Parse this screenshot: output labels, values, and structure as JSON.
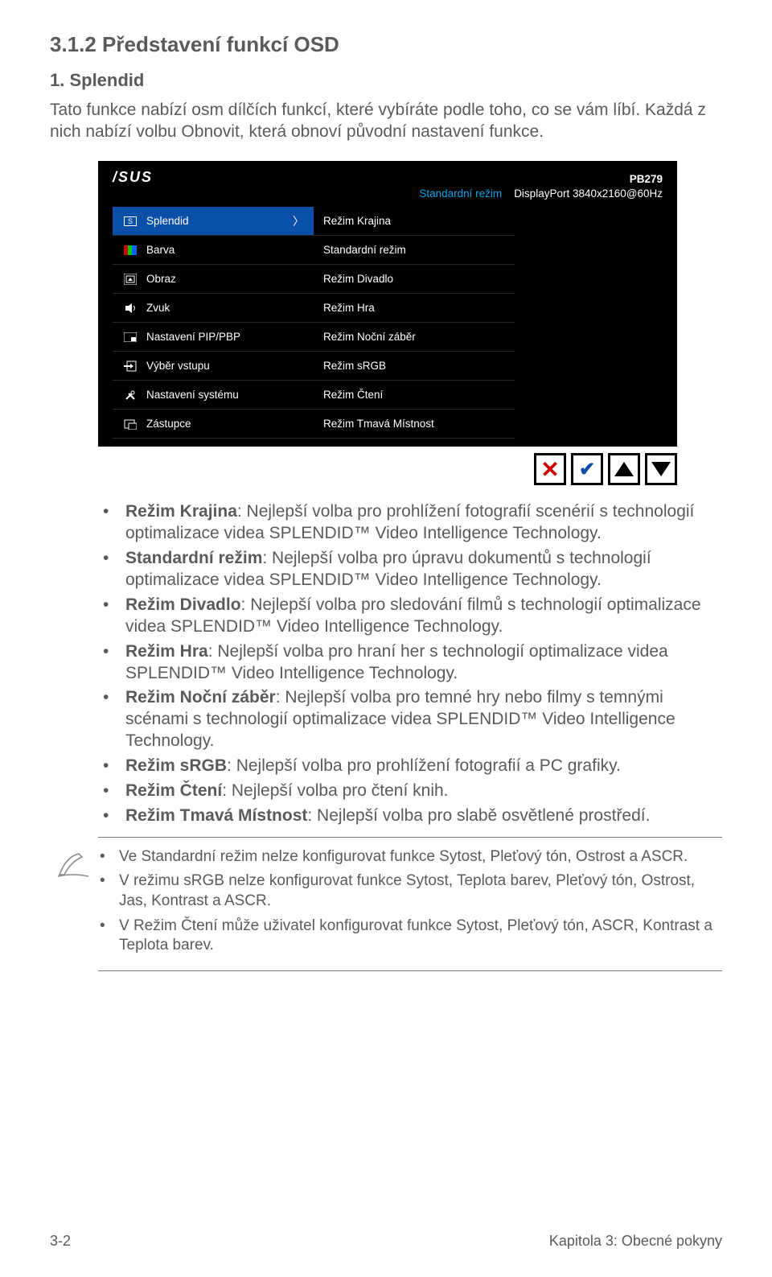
{
  "heading": "3.1.2   Představení funkcí OSD",
  "subheading": "1.   Splendid",
  "intro": "Tato funkce nabízí osm dílčích funkcí, které vybíráte podle toho, co se vám líbí. Každá z nich nabízí volbu Obnovit, která obnoví původní nastavení funkce.",
  "osd": {
    "brand": "/SUS",
    "model": "PB279",
    "status_mode": "Standardní režim",
    "status_signal": "DisplayPort 3840x2160@60Hz",
    "left_menu": [
      {
        "icon": "S",
        "label": "Splendid",
        "selected": true,
        "chevron": true
      },
      {
        "icon": "color",
        "label": "Barva"
      },
      {
        "icon": "image",
        "label": "Obraz"
      },
      {
        "icon": "sound",
        "label": "Zvuk"
      },
      {
        "icon": "pip",
        "label": "Nastavení PIP/PBP"
      },
      {
        "icon": "input",
        "label": "Výběr vstupu"
      },
      {
        "icon": "system",
        "label": "Nastavení systému"
      },
      {
        "icon": "shortcut",
        "label": "Zástupce"
      }
    ],
    "right_menu": [
      "Režim Krajina",
      "Standardní režim",
      "Režim Divadlo",
      "Režim Hra",
      "Režim Noční záběr",
      "Režim sRGB",
      "Režim Čtení",
      "Režim Tmavá Místnost"
    ]
  },
  "controls": {
    "close": "✕",
    "confirm": "✔"
  },
  "bullet_items": [
    {
      "bold": "Režim Krajina",
      "rest": ": Nejlepší volba pro prohlížení fotografií scenérií s technologií optimalizace videa SPLENDID™ Video Intelligence Technology."
    },
    {
      "bold": "Standardní režim",
      "rest": ": Nejlepší volba pro úpravu dokumentů s technologií optimalizace videa SPLENDID™ Video Intelligence Technology."
    },
    {
      "bold": "Režim Divadlo",
      "rest": ": Nejlepší volba pro sledování filmů s technologií optimalizace videa SPLENDID™ Video Intelligence Technology."
    },
    {
      "bold": "Režim Hra",
      "rest": ": Nejlepší volba pro hraní her s technologií optimalizace videa SPLENDID™ Video Intelligence Technology."
    },
    {
      "bold": "Režim Noční záběr",
      "rest": ": Nejlepší volba pro temné hry nebo filmy s temnými scénami s technologií optimalizace videa SPLENDID™ Video Intelligence Technology."
    },
    {
      "bold": "Režim sRGB",
      "rest": ": Nejlepší volba pro prohlížení fotografií a PC grafiky."
    },
    {
      "bold": "Režim Čtení",
      "rest": ": Nejlepší volba pro čtení knih."
    },
    {
      "bold": "Režim Tmavá Místnost",
      "rest": ": Nejlepší volba pro slabě osvětlené prostředí."
    }
  ],
  "notes": [
    "Ve Standardní režim nelze konfigurovat funkce Sytost, Pleťový tón, Ostrost a ASCR.",
    "V režimu sRGB nelze konfigurovat funkce Sytost, Teplota barev, Pleťový tón, Ostrost, Jas, Kontrast a ASCR.",
    "V Režim Čtení může uživatel konfigurovat funkce Sytost, Pleťový tón, ASCR, Kontrast a Teplota barev."
  ],
  "footer": {
    "left": "3-2",
    "right": "Kapitola 3: Obecné pokyny"
  }
}
